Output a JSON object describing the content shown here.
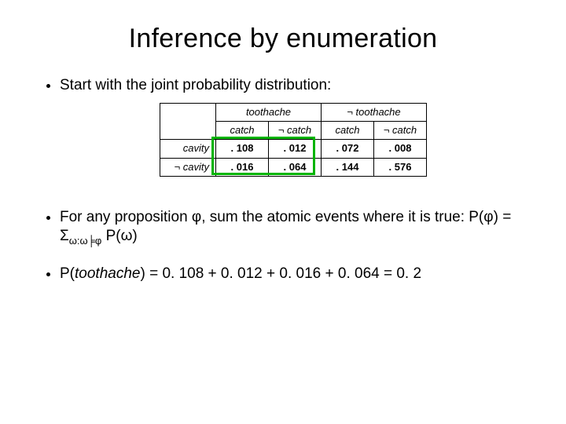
{
  "title": "Inference by enumeration",
  "bullets": {
    "b1": "Start with the joint probability distribution:",
    "b2_pre": "For any proposition φ, sum the atomic events where it is true: P(φ) = Σ",
    "b2_sub": "ω:ω╞φ",
    "b2_post": " P(ω)",
    "b3_pre": "P(",
    "b3_italic": "toothache",
    "b3_post": ") = 0. 108 + 0. 012 + 0. 016 + 0. 064 = 0. 2"
  },
  "table": {
    "top": {
      "toothache": "toothache",
      "not_toothache": "¬ toothache"
    },
    "sub": {
      "catch": "catch",
      "not_catch": "¬ catch"
    },
    "rows": {
      "cavity": "cavity",
      "not_cavity": "¬ cavity"
    },
    "cells": {
      "r1c1": ". 108",
      "r1c2": ". 012",
      "r1c3": ". 072",
      "r1c4": ". 008",
      "r2c1": ". 016",
      "r2c2": ". 064",
      "r2c3": ". 144",
      "r2c4": ". 576"
    }
  },
  "chart_data": {
    "type": "table",
    "title": "Joint probability distribution",
    "row_variable": "cavity",
    "col_variables": [
      "toothache",
      "catch"
    ],
    "rows": [
      "cavity",
      "¬cavity"
    ],
    "columns": [
      {
        "toothache": true,
        "catch": true
      },
      {
        "toothache": true,
        "catch": false
      },
      {
        "toothache": false,
        "catch": true
      },
      {
        "toothache": false,
        "catch": false
      }
    ],
    "values": [
      [
        0.108,
        0.012,
        0.072,
        0.008
      ],
      [
        0.016,
        0.064,
        0.144,
        0.576
      ]
    ],
    "highlighted_columns": [
      "toothache=true"
    ],
    "computation": {
      "query": "P(toothache)",
      "sum_cells": [
        0.108,
        0.012,
        0.016,
        0.064
      ],
      "result": 0.2
    }
  }
}
